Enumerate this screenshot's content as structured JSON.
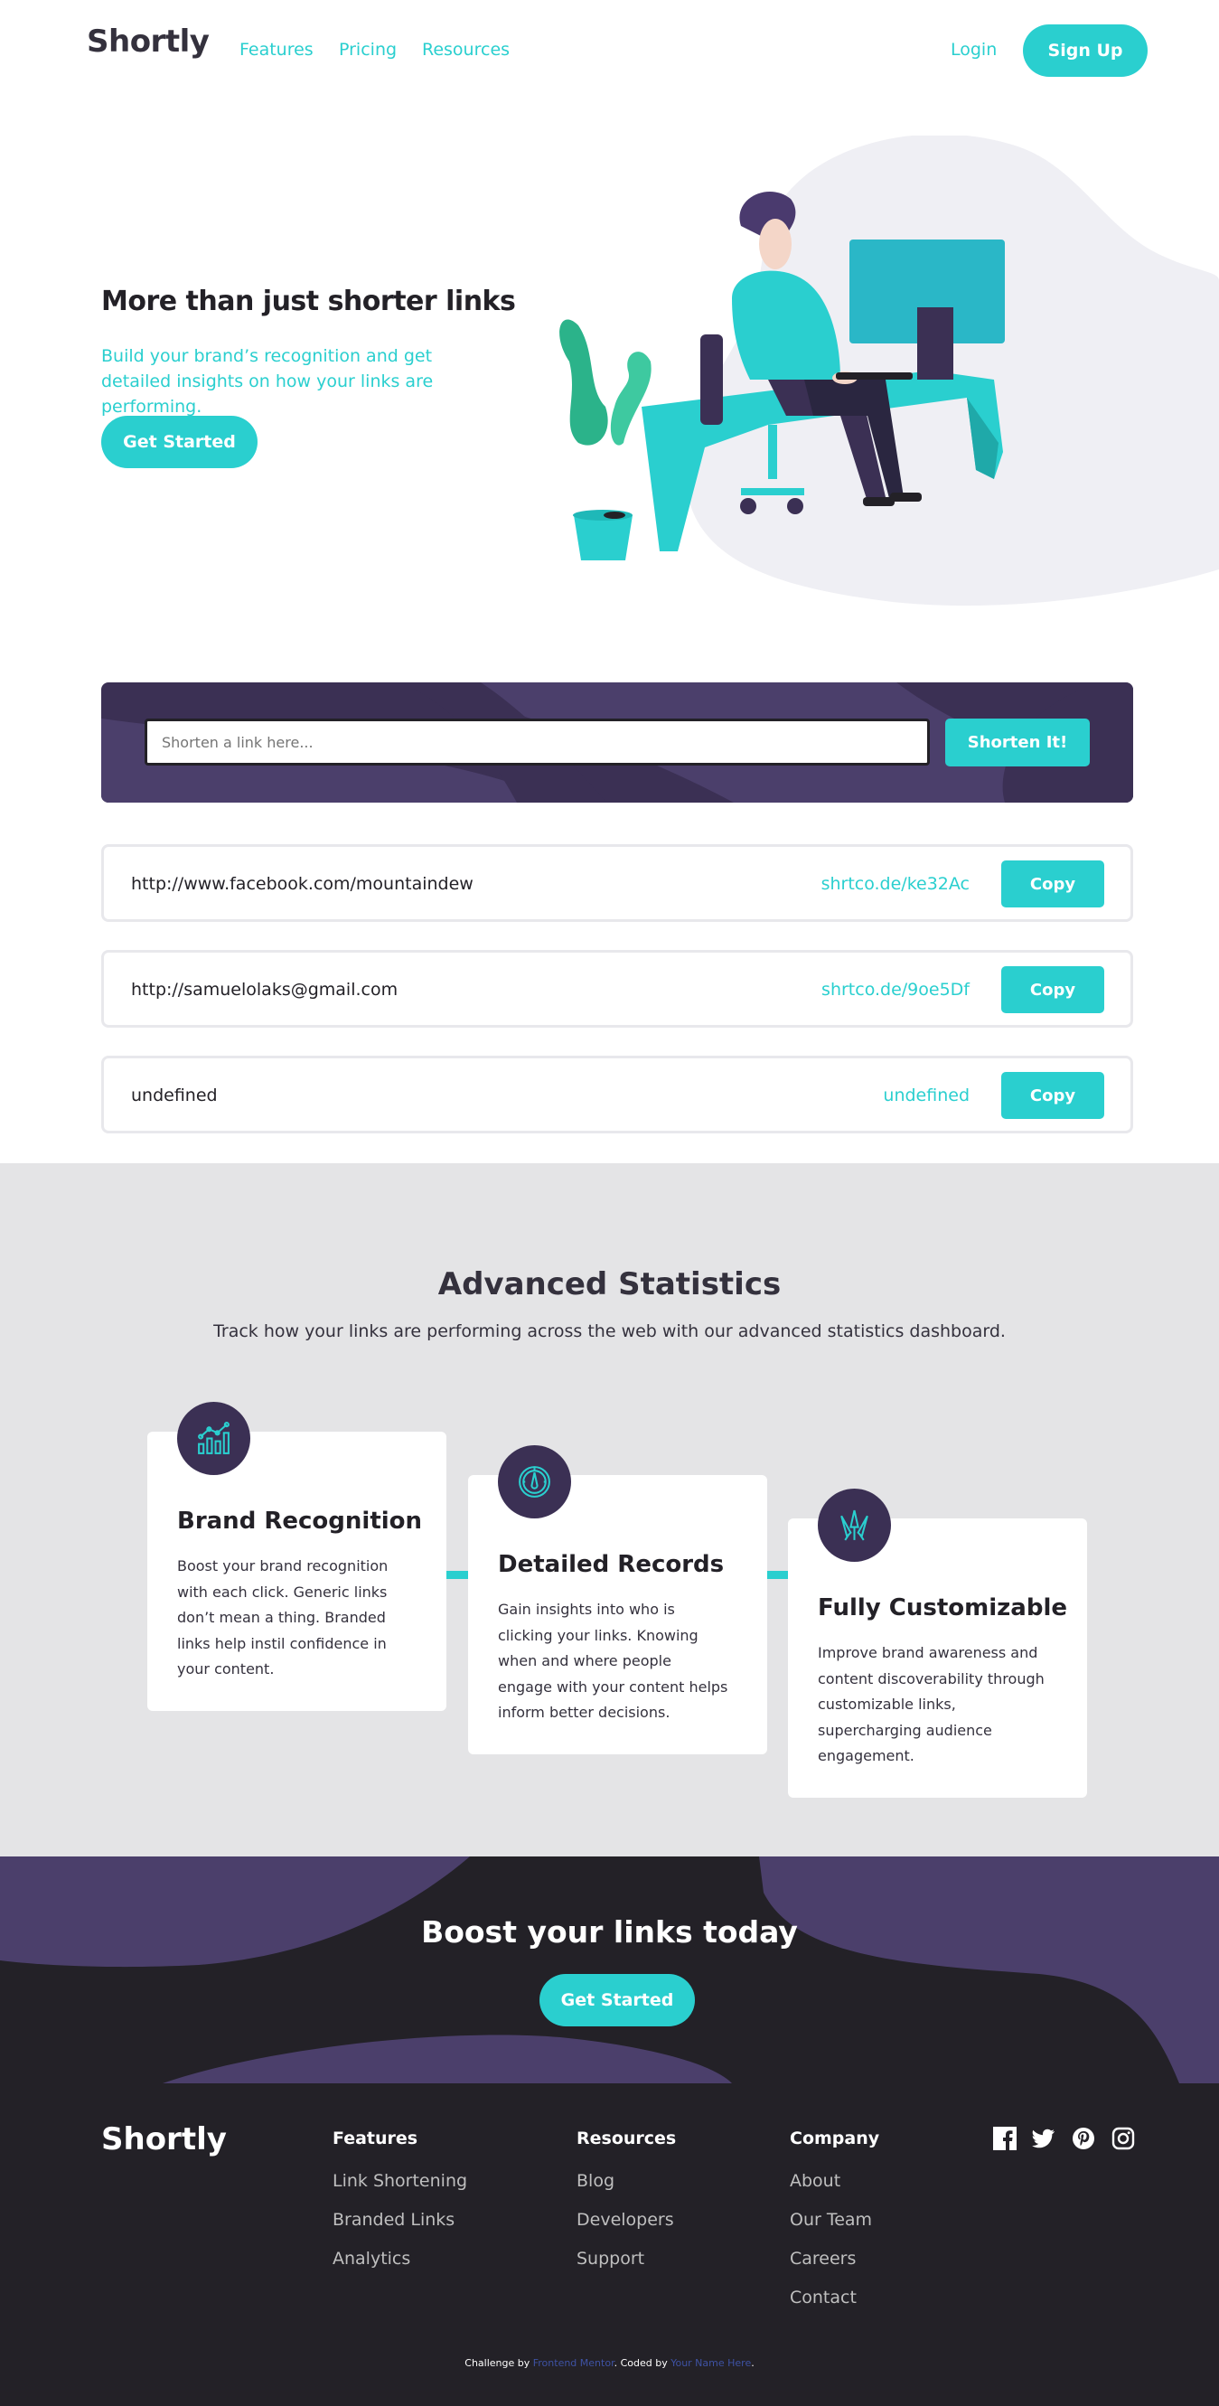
{
  "nav": {
    "logo": "Shortly",
    "links": [
      "Features",
      "Pricing",
      "Resources"
    ],
    "login": "Login",
    "signup": "Sign Up"
  },
  "hero": {
    "title": "More than just shorter links",
    "subtitle": "Build your brand’s recognition and get detailed insights on how your links are performing.",
    "cta": "Get Started"
  },
  "shorten": {
    "placeholder": "Shorten a link here...",
    "button": "Shorten It!"
  },
  "results": [
    {
      "original": "http://www.facebook.com/mountaindew",
      "short": "shrtco.de/ke32Ac",
      "button": "Copy"
    },
    {
      "original": "http://samuelolaks@gmail.com",
      "short": "shrtco.de/9oe5Df",
      "button": "Copy"
    },
    {
      "original": "undefined",
      "short": "undefined",
      "button": "Copy"
    }
  ],
  "stats": {
    "title": "Advanced Statistics",
    "subtitle": "Track how your links are performing across the web with our advanced statistics dashboard.",
    "cards": [
      {
        "icon": "chart-icon",
        "title": "Brand Recognition",
        "text": "Boost your brand recognition with each click. Generic links don’t mean a thing. Branded links help instil confidence in your content."
      },
      {
        "icon": "gauge-icon",
        "title": "Detailed Records",
        "text": "Gain insights into who is clicking your links. Knowing when and where people engage with your content helps inform better decisions."
      },
      {
        "icon": "brushes-icon",
        "title": "Fully Customizable",
        "text": "Improve brand awareness and content discoverability through customizable links, supercharging audience engagement."
      }
    ]
  },
  "boost": {
    "title": "Boost your links today",
    "cta": "Get Started"
  },
  "footer": {
    "logo": "Shortly",
    "columns": [
      {
        "heading": "Features",
        "links": [
          "Link Shortening",
          "Branded Links",
          "Analytics"
        ]
      },
      {
        "heading": "Resources",
        "links": [
          "Blog",
          "Developers",
          "Support"
        ]
      },
      {
        "heading": "Company",
        "links": [
          "About",
          "Our Team",
          "Careers",
          "Contact"
        ]
      }
    ],
    "social": [
      "facebook-icon",
      "twitter-icon",
      "pinterest-icon",
      "instagram-icon"
    ],
    "attribution": {
      "prefix": "Challenge by ",
      "link1": "Frontend Mentor",
      "middle": ". Coded by ",
      "link2": "Your Name Here",
      "suffix": "."
    }
  },
  "colors": {
    "cyan": "#2acfcf",
    "dark_violet": "#3b3054",
    "very_dark_violet": "#232127",
    "gray_bg": "#e4e4e6"
  }
}
